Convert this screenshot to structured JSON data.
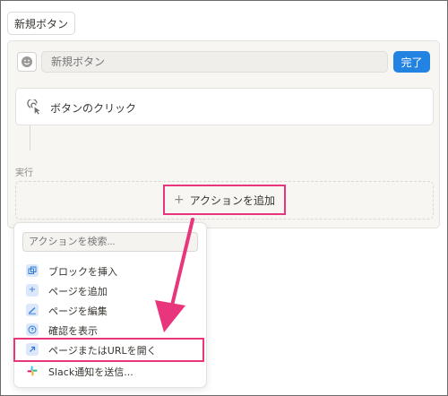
{
  "header": {
    "new_button_label": "新規ボタン"
  },
  "editor": {
    "name_placeholder": "新規ボタン",
    "done_label": "完了",
    "trigger_label": "ボタンのクリック",
    "run_label": "実行",
    "add_action_label": "アクションを追加"
  },
  "dropdown": {
    "search_placeholder": "アクションを検索...",
    "items": [
      {
        "label": "ブロックを挿入",
        "icon": "copy-block-icon"
      },
      {
        "label": "ページを追加",
        "icon": "plus-icon"
      },
      {
        "label": "ページを編集",
        "icon": "edit-icon"
      },
      {
        "label": "確認を表示",
        "icon": "question-icon"
      },
      {
        "label": "ページまたはURLを開く",
        "icon": "open-link-icon"
      },
      {
        "label": "Slack通知を送信...",
        "icon": "slack-icon"
      }
    ]
  },
  "colors": {
    "accent_blue": "#2383e2",
    "highlight_pink": "#e8357b",
    "panel_bg": "#f7f6f3"
  }
}
